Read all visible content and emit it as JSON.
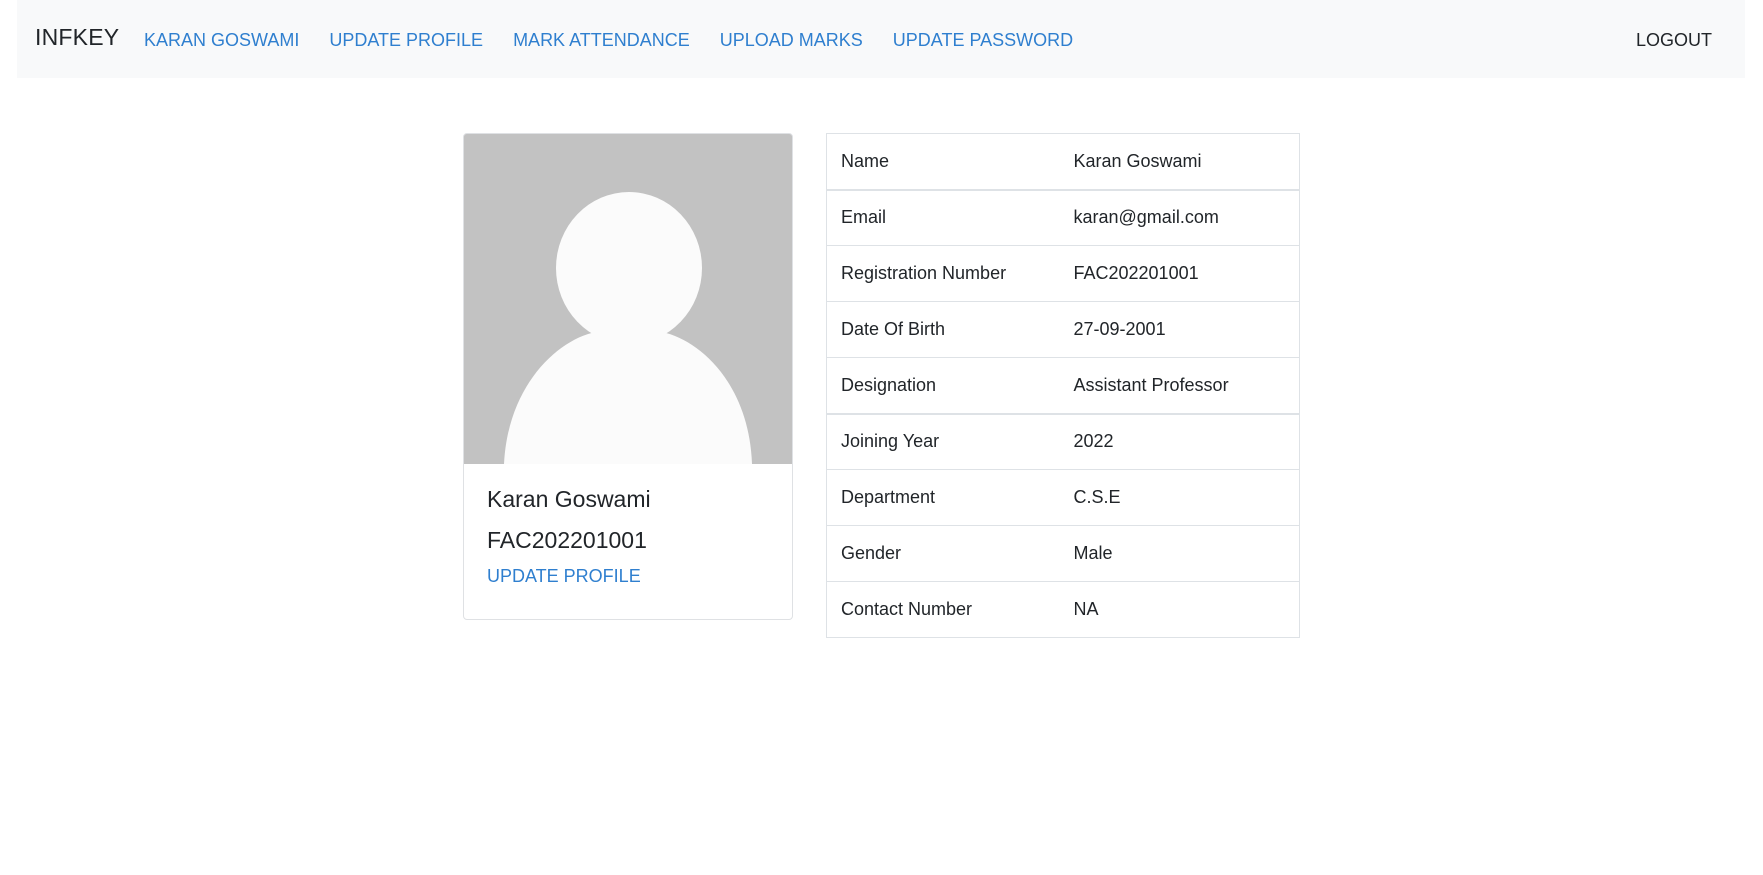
{
  "navbar": {
    "brand": "INFKEY",
    "links": [
      "KARAN GOSWAMI",
      "UPDATE PROFILE",
      "MARK ATTENDANCE",
      "UPLOAD MARKS",
      "UPDATE PASSWORD"
    ],
    "logout": "LOGOUT"
  },
  "profile_card": {
    "avatar_icon": "user-silhouette-icon",
    "name": "Karan Goswami",
    "registration": "FAC202201001",
    "update_link": "UPDATE PROFILE"
  },
  "details": [
    {
      "label": "Name",
      "value": "Karan Goswami"
    },
    {
      "label": "Email",
      "value": "karan@gmail.com"
    },
    {
      "label": "Registration Number",
      "value": "FAC202201001"
    },
    {
      "label": "Date Of Birth",
      "value": "27-09-2001"
    },
    {
      "label": "Designation",
      "value": "Assistant Professor"
    },
    {
      "label": "Joining Year",
      "value": "2022"
    },
    {
      "label": "Department",
      "value": "C.S.E"
    },
    {
      "label": "Gender",
      "value": "Male"
    },
    {
      "label": "Contact Number",
      "value": "NA"
    }
  ],
  "colors": {
    "link": "#2f7fcf",
    "navbar_bg": "#f8f9fa",
    "avatar_bg": "#c2c2c2"
  }
}
